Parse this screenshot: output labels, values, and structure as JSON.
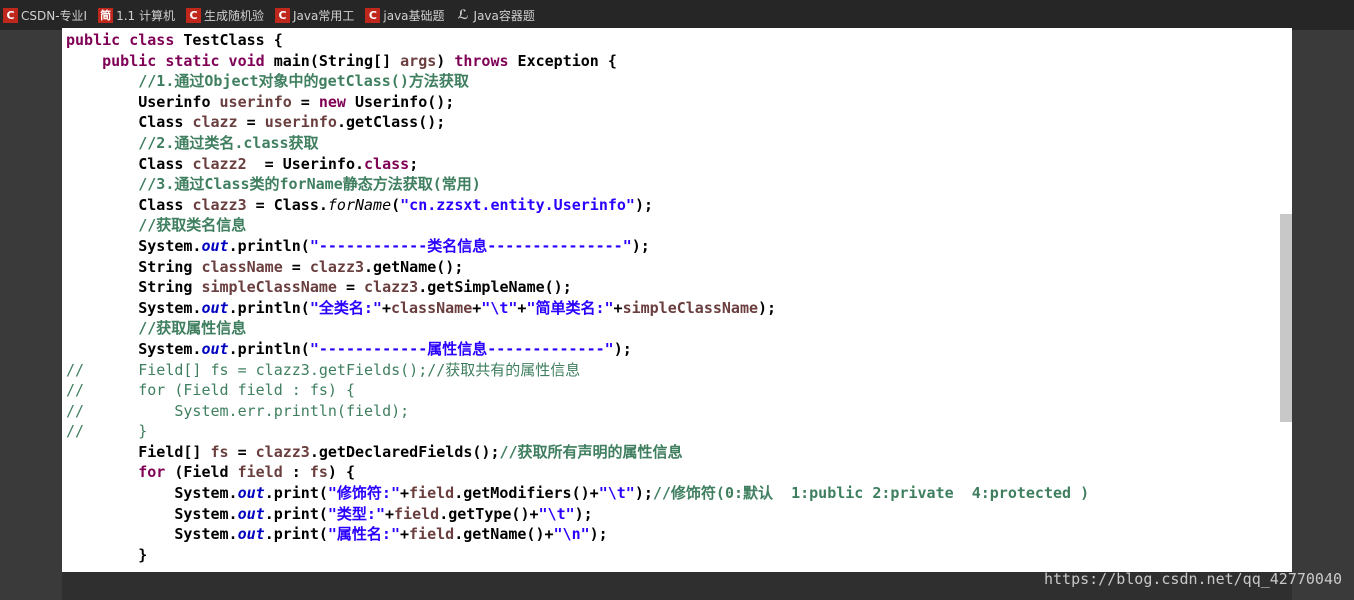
{
  "bookmarks": [
    {
      "label": "CSDN-专业I",
      "icon": "csdn-icon",
      "icon_char": "C"
    },
    {
      "label": "1.1 计算机",
      "icon": "page-icon",
      "icon_char": "简"
    },
    {
      "label": "生成随机验",
      "icon": "csdn-icon",
      "icon_char": "C"
    },
    {
      "label": "Java常用工",
      "icon": "csdn-icon",
      "icon_char": "C"
    },
    {
      "label": "java基础题",
      "icon": "csdn-icon",
      "icon_char": "C"
    },
    {
      "label": "Java容器题",
      "icon": "leaf-icon",
      "icon_char": "ℒ"
    }
  ],
  "code": {
    "l1": {
      "a": "public class ",
      "b": "TestClass {"
    },
    "l2": {
      "a": "public static void ",
      "b": "main(String[] ",
      "c": "args",
      "d": ") ",
      "e": "throws",
      "f": " Exception {"
    },
    "l3": "//1.通过Object对象中的getClass()方法获取",
    "l4": {
      "a": "Userinfo ",
      "b": "userinfo",
      "c": " = ",
      "d": "new",
      "e": " Userinfo();"
    },
    "l5": {
      "a": "Class ",
      "b": "clazz",
      "c": " = ",
      "d": "userinfo",
      "e": ".getClass();"
    },
    "l6": "//2.通过类名.class获取",
    "l7": {
      "a": "Class ",
      "b": "clazz2",
      "c": "  = Userinfo.",
      "d": "class",
      "e": ";"
    },
    "l8": "//3.通过Class类的forName静态方法获取(常用)",
    "l9": {
      "a": "Class ",
      "b": "clazz3",
      "c": " = Class.",
      "d": "forName",
      "e": "(",
      "f": "\"cn.zzsxt.entity.Userinfo\"",
      "g": ");"
    },
    "l10": "//获取类名信息",
    "l11": {
      "a": "System.",
      "b": "out",
      "c": ".println(",
      "d": "\"------------类名信息---------------\"",
      "e": ");"
    },
    "l12": {
      "a": "String ",
      "b": "className",
      "c": " = ",
      "d": "clazz3",
      "e": ".getName();"
    },
    "l13": {
      "a": "String ",
      "b": "simpleClassName",
      "c": " = ",
      "d": "clazz3",
      "e": ".getSimpleName();"
    },
    "l14": {
      "a": "System.",
      "b": "out",
      "c": ".println(",
      "d": "\"全类名:\"",
      "e": "+",
      "f": "className",
      "g": "+",
      "h": "\"\\t\"",
      "i": "+",
      "j": "\"简单类名:\"",
      "k": "+",
      "l": "simpleClassName",
      "m": ");"
    },
    "l15": "//获取属性信息",
    "l16": {
      "a": "System.",
      "b": "out",
      "c": ".println(",
      "d": "\"------------属性信息-------------\"",
      "e": ");"
    },
    "l17": {
      "a": "//",
      "b": "      Field[] ",
      "c": "fs",
      "d": " = clazz3.getFields();//获取共有的属性信息"
    },
    "l18": {
      "a": "//",
      "b": "      for (Field ",
      "c": "field",
      "d": " : ",
      "e": "fs",
      "f": ") {"
    },
    "l19": {
      "a": "//",
      "b": "          System.err.println(field);"
    },
    "l20": {
      "a": "//",
      "b": "      }"
    },
    "l21": {
      "a": "Field[] ",
      "b": "fs",
      "c": " = ",
      "d": "clazz3",
      "e": ".getDeclaredFields();",
      "f": "//获取所有声明的属性信息"
    },
    "l22": {
      "a": "for",
      "b": " (Field ",
      "c": "field",
      "d": " : ",
      "e": "fs",
      "f": ") {"
    },
    "l23": {
      "a": "System.",
      "b": "out",
      "c": ".print(",
      "d": "\"修饰符:\"",
      "e": "+",
      "f": "field",
      "g": ".getModifiers()+",
      "h": "\"\\t\"",
      "i": ");",
      "j": "//修饰符(0:默认  1:public 2:private  4:protected )"
    },
    "l24": {
      "a": "System.",
      "b": "out",
      "c": ".print(",
      "d": "\"类型:\"",
      "e": "+",
      "f": "field",
      "g": ".getType()+",
      "h": "\"\\t\"",
      "i": ");"
    },
    "l25": {
      "a": "System.",
      "b": "out",
      "c": ".print(",
      "d": "\"属性名:\"",
      "e": "+",
      "f": "field",
      "g": ".getName()+",
      "h": "\"\\n\"",
      "i": ");"
    },
    "l26": "}"
  },
  "watermark": "https://blog.csdn.net/qq_42770040",
  "colors": {
    "keyword": "#7f0055",
    "comment": "#3f7f5f",
    "string": "#2a00ff",
    "static_field": "#0000c0",
    "local_variable": "#6a3e3e",
    "bookmark_icon": "#c0281e"
  }
}
